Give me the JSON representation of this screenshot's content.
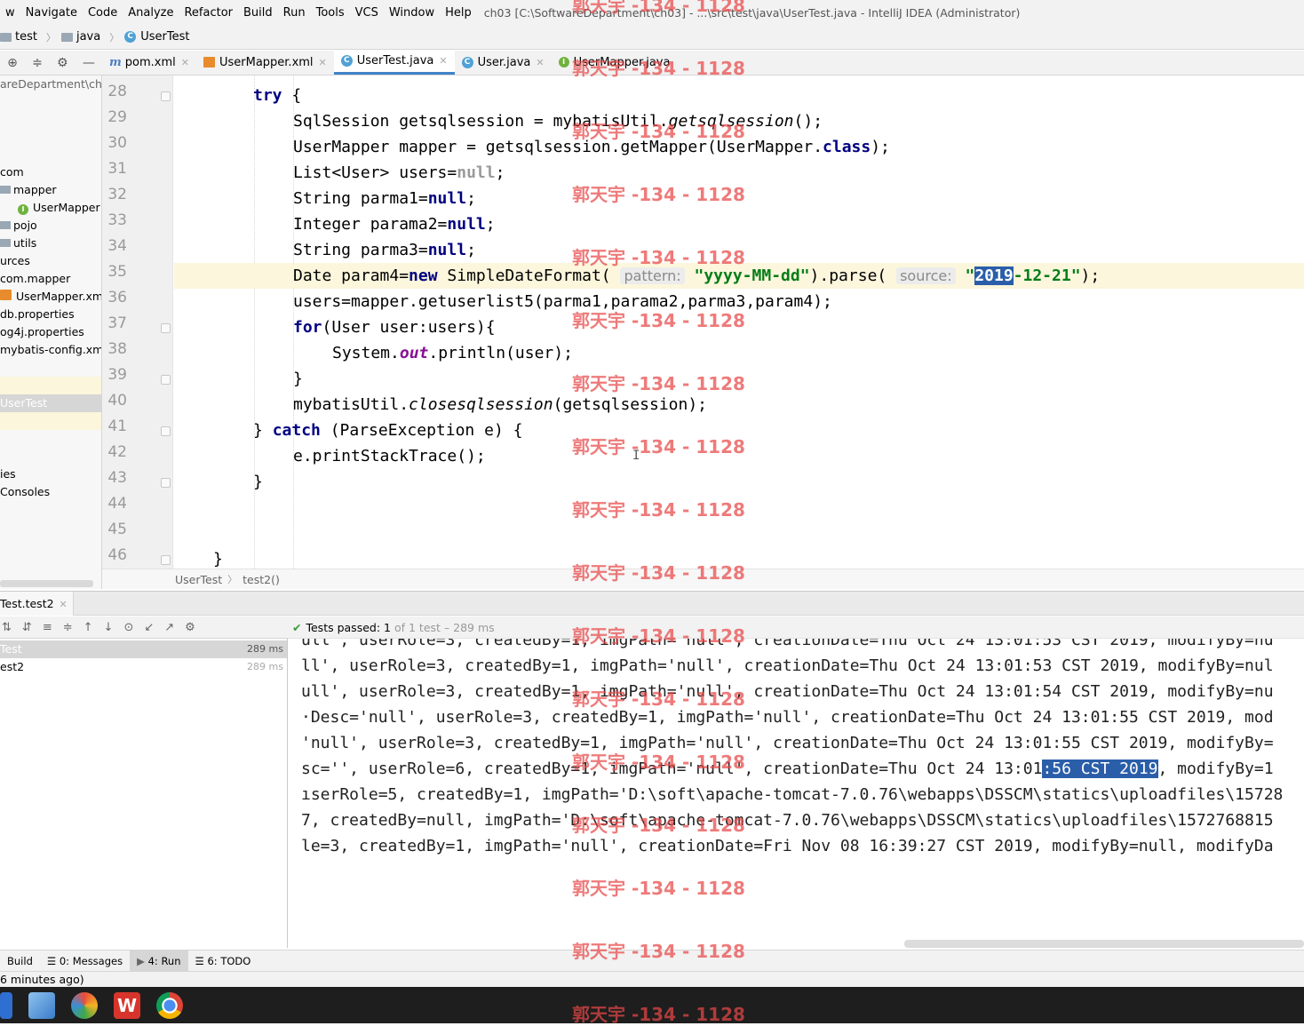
{
  "menu": {
    "items": [
      "w",
      "Navigate",
      "Code",
      "Analyze",
      "Refactor",
      "Build",
      "Run",
      "Tools",
      "VCS",
      "Window",
      "Help"
    ],
    "window_title": "ch03 [C:\\SoftwareDepartment\\ch03] - ...\\src\\test\\java\\UserTest.java - IntelliJ IDEA (Administrator)"
  },
  "nav": {
    "crumbs": [
      "test",
      "java",
      "UserTest"
    ]
  },
  "tabs": [
    {
      "label": "pom.xml",
      "icon": "maven-icon"
    },
    {
      "label": "UserMapper.xml",
      "icon": "xml-icon"
    },
    {
      "label": "UserTest.java",
      "icon": "class-icon",
      "active": true
    },
    {
      "label": "User.java",
      "icon": "class-icon"
    },
    {
      "label": "UserMapper.java",
      "icon": "interface-icon"
    }
  ],
  "tree": {
    "path_label": "areDepartment\\ch0",
    "items": [
      "com",
      "mapper",
      "UserMapper",
      "pojo",
      "utils",
      "urces",
      "com.mapper",
      "UserMapper.xml",
      "db.properties",
      "og4j.properties",
      "mybatis-config.xml",
      "",
      "UserTest",
      "",
      "ies",
      "Consoles"
    ]
  },
  "editor": {
    "line_numbers": [
      "28",
      "29",
      "30",
      "31",
      "32",
      "33",
      "34",
      "35",
      "36",
      "37",
      "38",
      "39",
      "40",
      "41",
      "42",
      "43",
      "44",
      "45",
      "46"
    ],
    "current_line": "35",
    "code": {
      "l28_kw": "try",
      "l28_rest": " {",
      "l29_a": "SqlSession getsqlsession = mybatisUtil.",
      "l29_b": "getsqlsession",
      "l29_c": "();",
      "l30_a": "UserMapper mapper = getsqlsession.getMapper(UserMapper.",
      "l30_kw": "class",
      "l30_c": ");",
      "l31_a": "List<User> users=",
      "l31_kw": "null",
      "l31_c": ";",
      "l32_a": "String parma1=",
      "l32_kw": "null",
      "l32_c": ";",
      "l33_a": "Integer parama2=",
      "l33_kw": "null",
      "l33_c": ";",
      "l34_a": "String parma3=",
      "l34_kw": "null",
      "l34_c": ";",
      "l35_a": "Date param4=",
      "l35_kw": "new",
      "l35_b": " SimpleDateFormat( ",
      "l35_hint1": "pattern:",
      "l35_str1": "\"yyyy-MM-dd\"",
      "l35_c": ").parse( ",
      "l35_hint2": "source:",
      "l35_str2a": "\"",
      "l35_sel": "2019",
      "l35_str2b": "-12-21\"",
      "l35_d": ");",
      "l36": "users=mapper.getuserlist5(parma1,parama2,parma3,param4);",
      "l37_kw": "for",
      "l37_rest": "(User user:users){",
      "l38_a": "System.",
      "l38_fld": "out",
      "l38_b": ".println(user);",
      "l39": "}",
      "l40_a": "mybatisUtil.",
      "l40_it": "closesqlsession",
      "l40_b": "(getsqlsession);",
      "l41_a": "} ",
      "l41_kw": "catch",
      "l41_b": " (ParseException e) {",
      "l42": "e.printStackTrace();",
      "l43": "}",
      "l46": "}"
    },
    "breadcrumb": [
      "UserTest",
      "test2()"
    ]
  },
  "run": {
    "tab_label": "Test.test2",
    "status_ok": "Tests passed:",
    "status_count": "1",
    "status_rest": "of 1 test – 289 ms",
    "tree": [
      {
        "label": "Test",
        "time": "289 ms"
      },
      {
        "label": "est2",
        "time": "289 ms"
      }
    ],
    "console": [
      "ull', userRole=3, createdBy=1, imgPath='null', creationDate=Thu Oct 24 13:01:53 CST 2019, modifyBy=nu",
      "ll', userRole=3, createdBy=1, imgPath='null', creationDate=Thu Oct 24 13:01:53 CST 2019, modifyBy=nul",
      "ull', userRole=3, createdBy=1, imgPath='null', creationDate=Thu Oct 24 13:01:54 CST 2019, modifyBy=nu",
      "·Desc='null', userRole=3, createdBy=1, imgPath='null', creationDate=Thu Oct 24 13:01:55 CST 2019, mod",
      "'null', userRole=3, createdBy=1, imgPath='null', creationDate=Thu Oct 24 13:01:55 CST 2019, modifyBy=",
      "ıserRole=5, createdBy=1, imgPath='D:\\soft\\apache-tomcat-7.0.76\\webapps\\DSSCM\\statics\\uploadfiles\\15728",
      "7, createdBy=null, imgPath='D:\\soft\\apache-tomcat-7.0.76\\webapps\\DSSCM\\statics\\uploadfiles\\1572768815",
      "le=3, createdBy=1, imgPath='null', creationDate=Fri Nov 08 16:39:27 CST 2019, modifyBy=null, modifyDa"
    ],
    "console_sel_line": {
      "a": "sc='', userRole=6, createdBy=1, imgPath='null', creationDate=Thu Oct 24 13:01",
      "sel": ":56 CST 2019",
      "b": ", modifyBy=1"
    }
  },
  "toolwindows": [
    {
      "label": "Build"
    },
    {
      "label": "0: Messages"
    },
    {
      "label": "4: Run",
      "active": true
    },
    {
      "label": "6: TODO"
    }
  ],
  "statusbar": "6 minutes ago)",
  "watermark": "郭天宇 -134 - 1128",
  "colors": {
    "keyword": "#000080",
    "string": "#067d17",
    "selection": "#2a5ea9",
    "current_line": "#fbf6dc",
    "accent_tab": "#4083c9"
  }
}
